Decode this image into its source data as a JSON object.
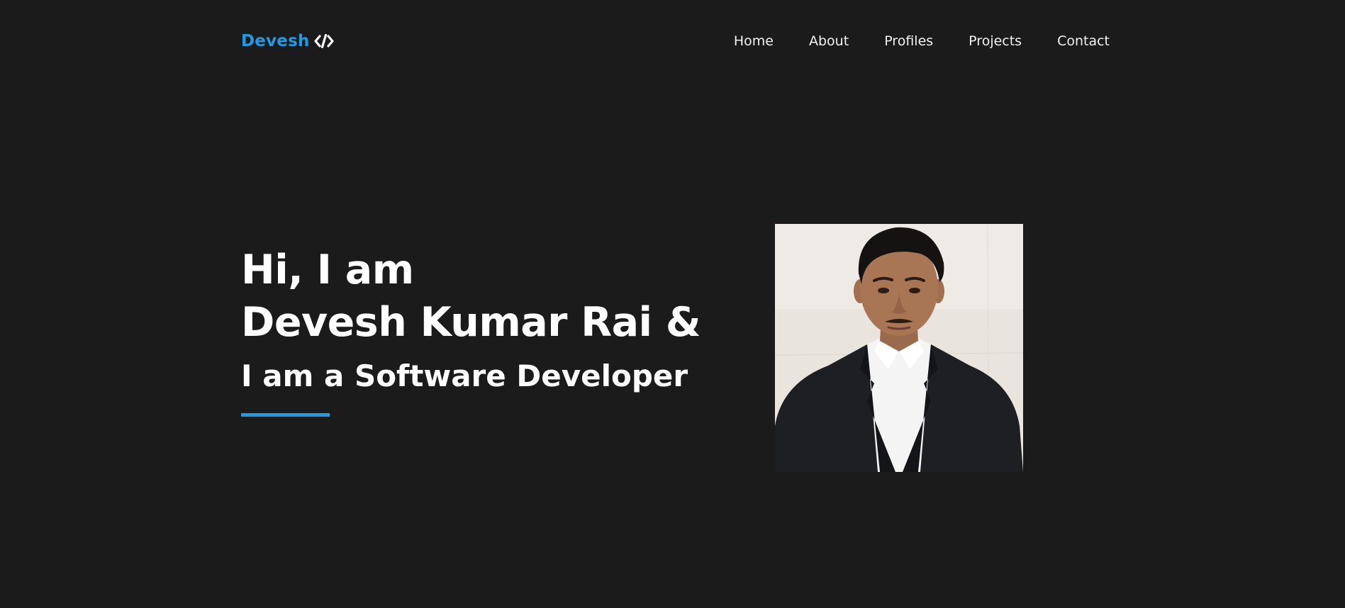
{
  "brand": {
    "name": "Devesh",
    "icon": "code-slash-icon",
    "accent_color": "#1d9be6"
  },
  "nav": {
    "items": [
      {
        "label": "Home"
      },
      {
        "label": "About"
      },
      {
        "label": "Profiles"
      },
      {
        "label": "Projects"
      },
      {
        "label": "Contact"
      }
    ]
  },
  "hero": {
    "greeting": "Hi, I am",
    "name": "Devesh Kumar Rai &",
    "role": "I am a Software Developer",
    "underline_color": "#1d9be6"
  },
  "portrait": {
    "alt": "profile-photo"
  },
  "theme": {
    "background": "#1b1b1b",
    "text": "#ffffff"
  }
}
